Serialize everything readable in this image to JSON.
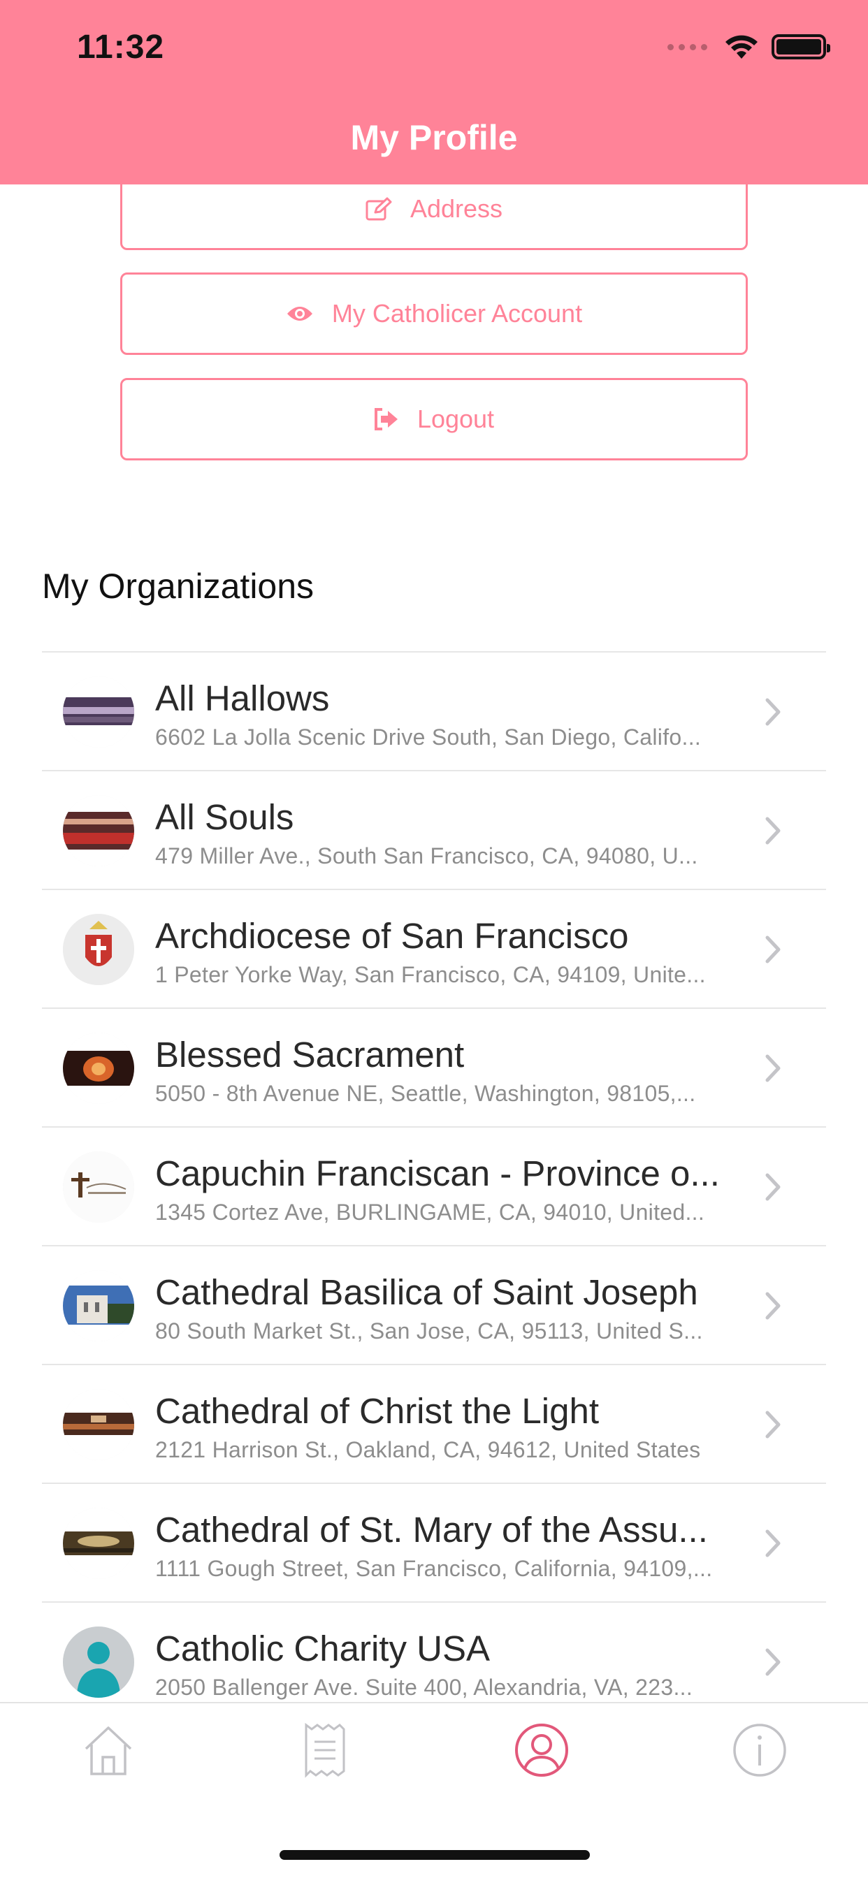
{
  "status_bar": {
    "time": "11:32"
  },
  "header": {
    "title": "My Profile"
  },
  "buttons": {
    "address": "Address",
    "account": "My Catholicer Account",
    "logout": "Logout"
  },
  "organizations": {
    "title": "My Organizations",
    "items": [
      {
        "name": "All Hallows",
        "address": "6602 La Jolla Scenic Drive South, San Diego, Califo..."
      },
      {
        "name": "All Souls",
        "address": "479 Miller Ave., South San Francisco, CA, 94080, U..."
      },
      {
        "name": "Archdiocese of San Francisco",
        "address": "1 Peter Yorke Way, San Francisco, CA, 94109, Unite..."
      },
      {
        "name": "Blessed Sacrament",
        "address": "5050 - 8th Avenue NE, Seattle, Washington, 98105,..."
      },
      {
        "name": "Capuchin Franciscan - Province o...",
        "address": "1345 Cortez Ave, BURLINGAME, CA, 94010, United..."
      },
      {
        "name": "Cathedral Basilica of Saint Joseph",
        "address": "80 South Market St., San Jose, CA, 95113, United S..."
      },
      {
        "name": "Cathedral of Christ the Light",
        "address": "2121 Harrison St., Oakland, CA, 94612, United States"
      },
      {
        "name": "Cathedral of St. Mary of the Assu...",
        "address": "1111 Gough Street, San Francisco, California, 94109,..."
      },
      {
        "name": "Catholic Charity USA",
        "address": "2050 Ballenger Ave. Suite 400, Alexandria, VA, 223..."
      }
    ]
  },
  "tabbar": {
    "active": "profile",
    "accent": "#E2587A"
  },
  "colors": {
    "brand": "#FF8398"
  }
}
